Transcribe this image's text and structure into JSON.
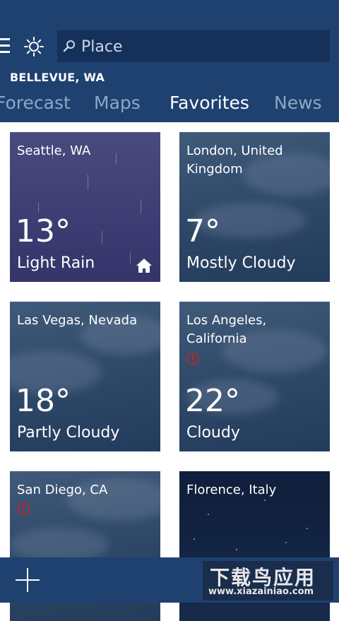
{
  "header": {
    "menu_icon": "hamburger-icon",
    "weather_icon": "sun-icon",
    "search_placeholder": "Place",
    "location": "BELLEVUE, WA"
  },
  "tabs": [
    {
      "label": "Forecast",
      "active": false
    },
    {
      "label": "Maps",
      "active": false
    },
    {
      "label": "Favorites",
      "active": true
    },
    {
      "label": "News",
      "active": false
    }
  ],
  "favorites": [
    {
      "city": "Seattle, WA",
      "temp": "13°",
      "condition": "Light Rain",
      "home": true,
      "alert": false
    },
    {
      "city": "London, United Kingdom",
      "temp": "7°",
      "condition": "Mostly Cloudy",
      "home": false,
      "alert": false
    },
    {
      "city": "Las Vegas, Nevada",
      "temp": "18°",
      "condition": "Partly Cloudy",
      "home": false,
      "alert": false
    },
    {
      "city": "Los Angeles, California",
      "temp": "22°",
      "condition": "Cloudy",
      "home": false,
      "alert": true
    },
    {
      "city": "San Diego, CA",
      "temp": "",
      "condition": "",
      "home": false,
      "alert": true
    },
    {
      "city": "Florence, Italy",
      "temp": "",
      "condition": "",
      "home": false,
      "alert": false
    }
  ],
  "bottom_bar": {
    "add_icon": "plus-icon"
  },
  "watermark": {
    "title": "下载鸟应用",
    "url": "www.xiazainiao.com"
  },
  "colors": {
    "bar": "#1f4170",
    "search_bg": "#15315a",
    "alert": "#d11f1f",
    "inactive_tab": "#8ea6c6"
  }
}
